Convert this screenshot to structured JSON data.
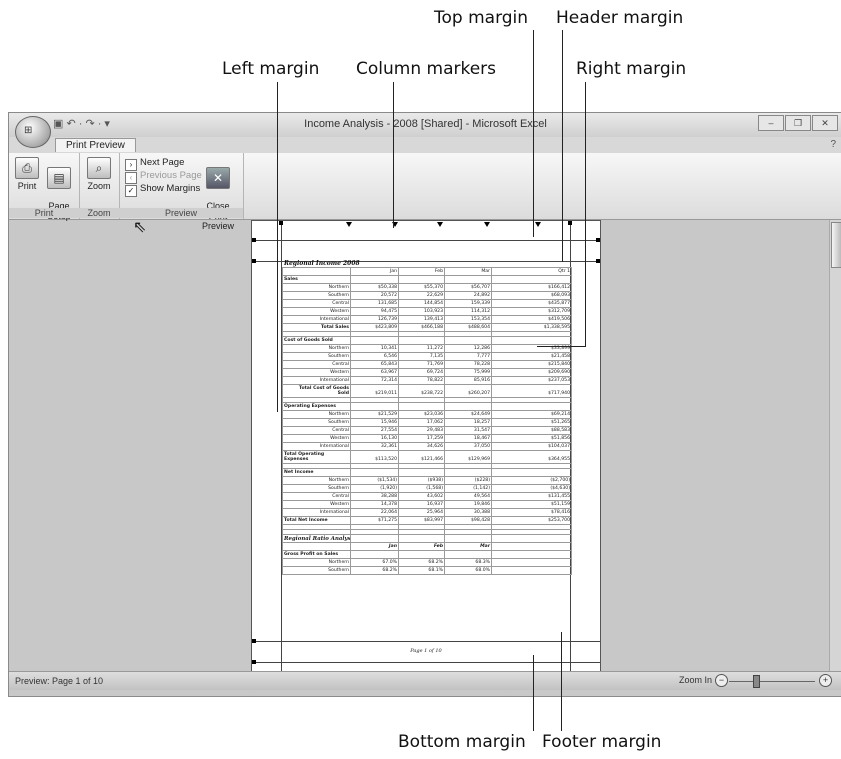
{
  "callouts": {
    "top_margin": "Top margin",
    "header_margin": "Header margin",
    "left_margin": "Left margin",
    "column_markers": "Column markers",
    "right_margin": "Right margin",
    "bottom_margin": "Bottom margin",
    "footer_margin": "Footer margin"
  },
  "window": {
    "title": "Income Analysis - 2008  [Shared] - Microsoft Excel",
    "quick_access": "▣  ↶ · ↷ ·  ▾",
    "help_icon": "help-icon"
  },
  "tabs": [
    "Print Preview"
  ],
  "ribbon": {
    "print_label": "Print",
    "page_setup_label": "Page\nSetup",
    "zoom_label": "Zoom",
    "next_page_label": "Next Page",
    "previous_page_label": "Previous Page",
    "show_margins_label": "Show Margins",
    "close_preview_label": "Close Print\nPreview",
    "group_print": "Print",
    "group_zoom": "Zoom",
    "group_preview": "Preview"
  },
  "sheet": {
    "title": "Regional Income 2008",
    "headers": [
      "",
      "Jan",
      "Feb",
      "Mar",
      "Qtr 1"
    ],
    "rows": [
      {
        "type": "section",
        "label": "Sales"
      },
      {
        "type": "data",
        "label": "Northern",
        "values": [
          "$50,338",
          "$55,370",
          "$56,707",
          "$166,412"
        ]
      },
      {
        "type": "data",
        "label": "Southern",
        "values": [
          "20,572",
          "22,629",
          "24,892",
          "$68,093"
        ]
      },
      {
        "type": "data",
        "label": "Central",
        "values": [
          "131,685",
          "144,854",
          "159,339",
          "$435,877"
        ]
      },
      {
        "type": "data",
        "label": "Western",
        "values": [
          "94,475",
          "103,923",
          "114,312",
          "$312,709"
        ]
      },
      {
        "type": "data",
        "label": "International",
        "values": [
          "126,739",
          "139,413",
          "153,354",
          "$419,506"
        ]
      },
      {
        "type": "total",
        "label": "Total Sales",
        "values": [
          "$423,809",
          "$466,188",
          "$488,604",
          "$1,338,595"
        ]
      },
      {
        "type": "gap"
      },
      {
        "type": "section",
        "label": "Cost of Goods Sold"
      },
      {
        "type": "data",
        "label": "Northern",
        "values": [
          "10,341",
          "11,272",
          "12,286",
          "$33,899"
        ]
      },
      {
        "type": "data",
        "label": "Southern",
        "values": [
          "6,546",
          "7,135",
          "7,777",
          "$21,458"
        ]
      },
      {
        "type": "data",
        "label": "Central",
        "values": [
          "65,843",
          "71,769",
          "78,228",
          "$215,840"
        ]
      },
      {
        "type": "data",
        "label": "Western",
        "values": [
          "63,967",
          "69,724",
          "75,999",
          "$209,690"
        ]
      },
      {
        "type": "data",
        "label": "International",
        "values": [
          "72,314",
          "78,822",
          "85,916",
          "$237,053"
        ]
      },
      {
        "type": "total2",
        "label": "Total Cost of Goods",
        "label2": "Sold",
        "values": [
          "$219,011",
          "$238,722",
          "$260,207",
          "$717,940"
        ]
      },
      {
        "type": "gap"
      },
      {
        "type": "section",
        "label": "Operating Expenses"
      },
      {
        "type": "data",
        "label": "Northern",
        "values": [
          "$21,529",
          "$23,036",
          "$24,649",
          "$69,214"
        ]
      },
      {
        "type": "data",
        "label": "Southern",
        "values": [
          "15,946",
          "17,062",
          "18,257",
          "$51,265"
        ]
      },
      {
        "type": "data",
        "label": "Central",
        "values": [
          "27,554",
          "29,483",
          "31,547",
          "$88,583"
        ]
      },
      {
        "type": "data",
        "label": "Western",
        "values": [
          "16,130",
          "17,259",
          "18,467",
          "$51,856"
        ]
      },
      {
        "type": "data",
        "label": "International",
        "values": [
          "32,361",
          "34,626",
          "37,050",
          "$104,037"
        ]
      },
      {
        "type": "total2s",
        "label": "Total Operating",
        "label2": "Expenses",
        "values": [
          "$113,520",
          "$121,466",
          "$129,969",
          "$364,955"
        ]
      },
      {
        "type": "gap"
      },
      {
        "type": "section",
        "label": "Net Income"
      },
      {
        "type": "data",
        "label": "Northern",
        "values": [
          "($1,534)",
          "($938)",
          "($228)",
          "($2,700)"
        ]
      },
      {
        "type": "data",
        "label": "Southern",
        "values": [
          "(1,920)",
          "(1,568)",
          "(1,142)",
          "($4,630)"
        ]
      },
      {
        "type": "data",
        "label": "Central",
        "values": [
          "38,288",
          "43,602",
          "49,564",
          "$131,455"
        ]
      },
      {
        "type": "data",
        "label": "Western",
        "values": [
          "14,378",
          "16,937",
          "19,846",
          "$51,159"
        ]
      },
      {
        "type": "data",
        "label": "International",
        "values": [
          "22,064",
          "25,964",
          "30,388",
          "$78,416"
        ]
      },
      {
        "type": "sectotal",
        "label": "Total Net Income",
        "values": [
          "$71,275",
          "$83,997",
          "$98,428",
          "$253,700"
        ]
      },
      {
        "type": "gap"
      },
      {
        "type": "gap"
      },
      {
        "type": "ratiotitle",
        "label": "Regional Ratio Analysis"
      },
      {
        "type": "ratiohead",
        "label": "",
        "values": [
          "Jan",
          "Feb",
          "Mar",
          ""
        ]
      },
      {
        "type": "section",
        "label": "Gross Profit on Sales"
      },
      {
        "type": "data",
        "label": "Northern",
        "values": [
          "67.0%",
          "68.2%",
          "68.3%",
          ""
        ]
      },
      {
        "type": "data",
        "label": "Southern",
        "values": [
          "68.2%",
          "68.1%",
          "68.0%",
          ""
        ]
      }
    ],
    "footer": "Page 1 of 10"
  },
  "status": {
    "left": "Preview: Page 1 of 10",
    "zoom": "Zoom In"
  }
}
